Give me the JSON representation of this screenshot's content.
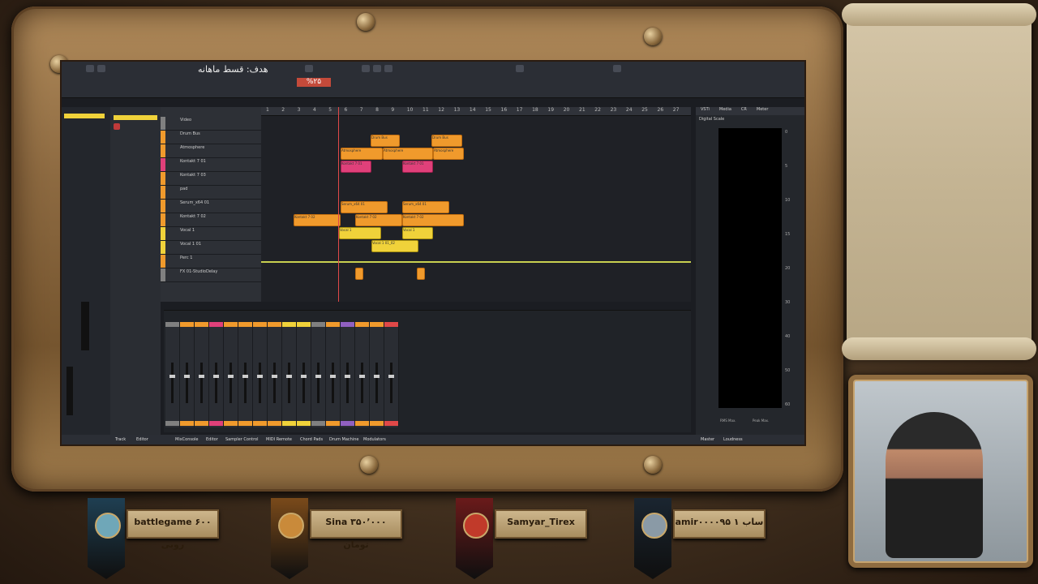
{
  "overlay": {
    "goal_text": "هدف: قسط ماهانه",
    "goal_percent": "%۲۵"
  },
  "daw": {
    "ruler_numbers": [
      "1",
      "2",
      "3",
      "4",
      "5",
      "6",
      "7",
      "8",
      "9",
      "10",
      "11",
      "12",
      "13",
      "14",
      "15",
      "16",
      "17",
      "18",
      "19",
      "20",
      "21",
      "22",
      "23",
      "24",
      "25",
      "26",
      "27"
    ],
    "tracks": [
      {
        "name": "Video",
        "color": "#808080"
      },
      {
        "name": "Drum Bus",
        "color": "#f09a2c"
      },
      {
        "name": "Atmosphere",
        "color": "#f09a2c"
      },
      {
        "name": "Kontakt 7 01",
        "color": "#e0407a"
      },
      {
        "name": "Kontakt 7 03",
        "color": "#f09a2c"
      },
      {
        "name": "pad",
        "color": "#f09a2c"
      },
      {
        "name": "Serum_x64 01",
        "color": "#f09a2c"
      },
      {
        "name": "Kontakt 7 02",
        "color": "#f09a2c"
      },
      {
        "name": "Vocal 1",
        "color": "#f0d23a"
      },
      {
        "name": "Vocal 1 01",
        "color": "#f0d23a"
      },
      {
        "name": "Perc 1",
        "color": "#f09a2c"
      },
      {
        "name": "FX 01-StudioDelay",
        "color": "#808080"
      }
    ],
    "clips": [
      "Drum Bus",
      "Drum Bus",
      "Atmosphere",
      "Atmosphere",
      "Atmosphere",
      "Kontakt 7 01",
      "Kontakt 7 01",
      "Serum_x64 01",
      "Serum_x64 01",
      "Kontakt 7 02",
      "Kontakt 7 02",
      "Kontakt 7 02",
      "Vocal 1",
      "Vocal 1",
      "Vocal 1 01_02"
    ],
    "meter_tabs": [
      "VSTi",
      "Media",
      "CR",
      "Meter"
    ],
    "meter_label": "Digital Scale",
    "meter_scale": [
      "0",
      "5",
      "10",
      "15",
      "20",
      "30",
      "40",
      "50",
      "60"
    ],
    "meter_footer": [
      "RMS Max.",
      "Peak Max."
    ],
    "bottom_tabs": [
      "Track",
      "Editor",
      "MixConsole",
      "Editor",
      "Sampler Control",
      "MIDI Remote",
      "Chord Pads",
      "Drum Machine",
      "Modulators",
      "Master",
      "Loudness"
    ]
  },
  "donors": [
    {
      "text": "battlegame ۶۰۰ روبی",
      "banner": "#1f3f52",
      "emblem": "#6fa7b8"
    },
    {
      "text": "Sina ۳۵۰٬۰۰۰ تومان",
      "banner": "#7a4a1a",
      "emblem": "#c98a3a"
    },
    {
      "text": "Samyar_Tirex",
      "banner": "#6a1a1a",
      "emblem": "#c13a2a"
    },
    {
      "text": "amir۰۰۰۰۹۵ ۱ ساب",
      "banner": "#1a2530",
      "emblem": "#8a9aa6"
    }
  ]
}
